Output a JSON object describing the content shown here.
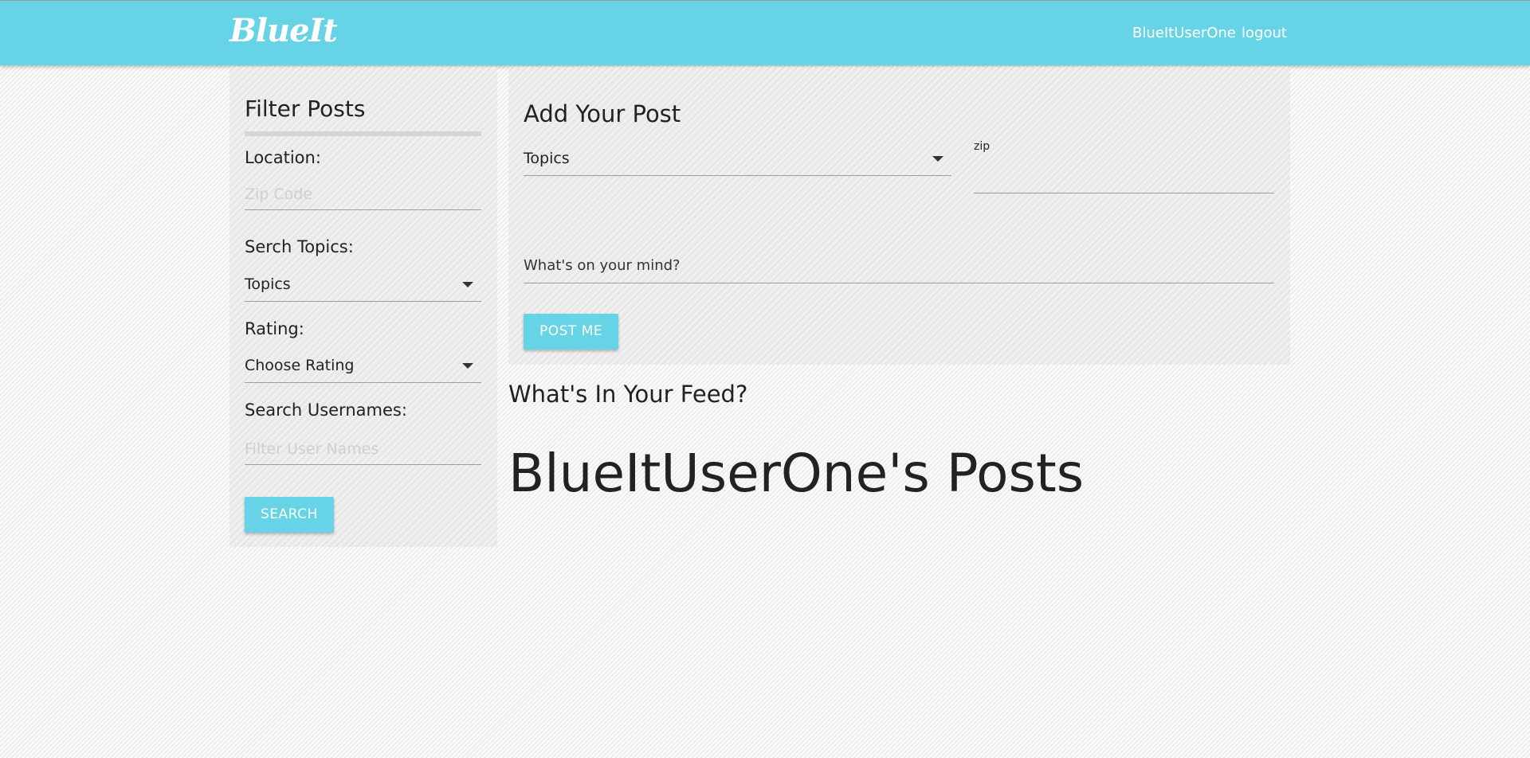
{
  "navbar": {
    "brand": "BlueIt",
    "username": "BlueItUserOne",
    "logout": "logout"
  },
  "filter": {
    "title": "Filter Posts",
    "location_label": "Location:",
    "zip_placeholder": "Zip Code",
    "topics_label": "Serch Topics:",
    "topics_value": "Topics",
    "rating_label": "Rating:",
    "rating_value": "Choose Rating",
    "usernames_label": "Search Usernames:",
    "usernames_placeholder": "Filter User Names",
    "search_button": "SEARCH"
  },
  "add_post": {
    "title": "Add Your Post",
    "topics_value": "Topics",
    "zip_label": "zip",
    "mind_placeholder": "What's on your mind?",
    "post_button": "POST ME"
  },
  "feed": {
    "heading": "What's In Your Feed?",
    "posts_heading": "BlueItUserOne's Posts"
  },
  "colors": {
    "accent": "#67d3e6"
  }
}
